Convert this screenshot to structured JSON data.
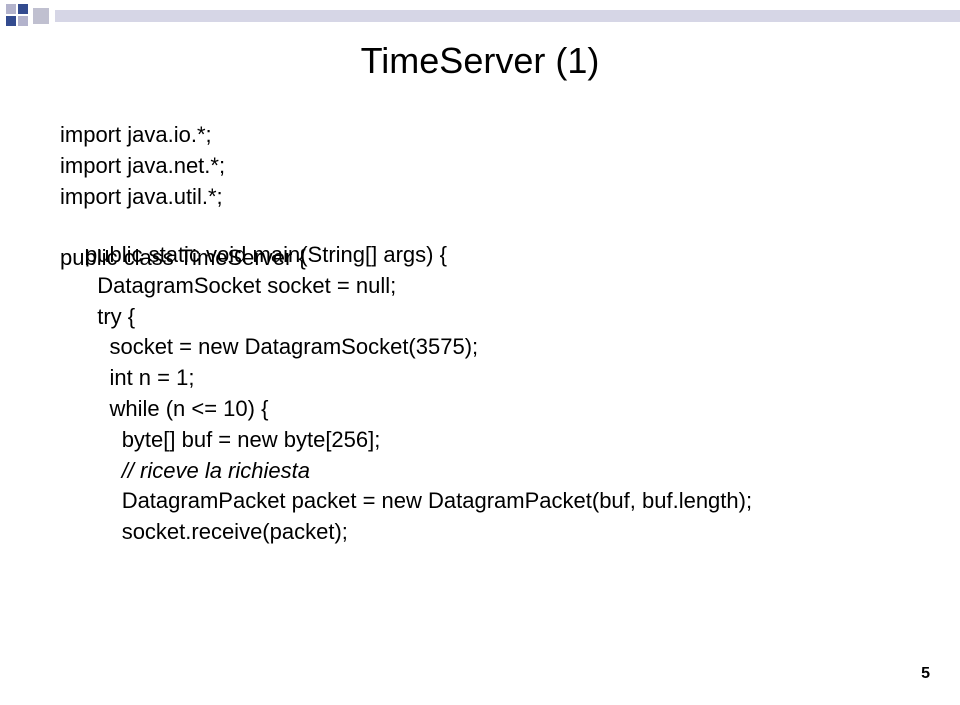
{
  "title": "TimeServer (1)",
  "code": {
    "imports": "import java.io.*;\nimport java.net.*;\nimport java.util.*;",
    "class_decl": "public class TimeServer {",
    "main_sig": "public static void main(String[] args) {",
    "sock_decl": "DatagramSocket socket = null;",
    "try_line": "try {",
    "sock_new": "socket = new DatagramSocket(3575);",
    "int_n": "int n = 1;",
    "while_line": "while (n <= 10) {",
    "buf_line": "byte[] buf = new byte[256];",
    "comment": "// riceve la richiesta",
    "packet_line": "DatagramPacket packet = new DatagramPacket(buf, buf.length);",
    "receive_line": "socket.receive(packet);"
  },
  "page_number": "5"
}
